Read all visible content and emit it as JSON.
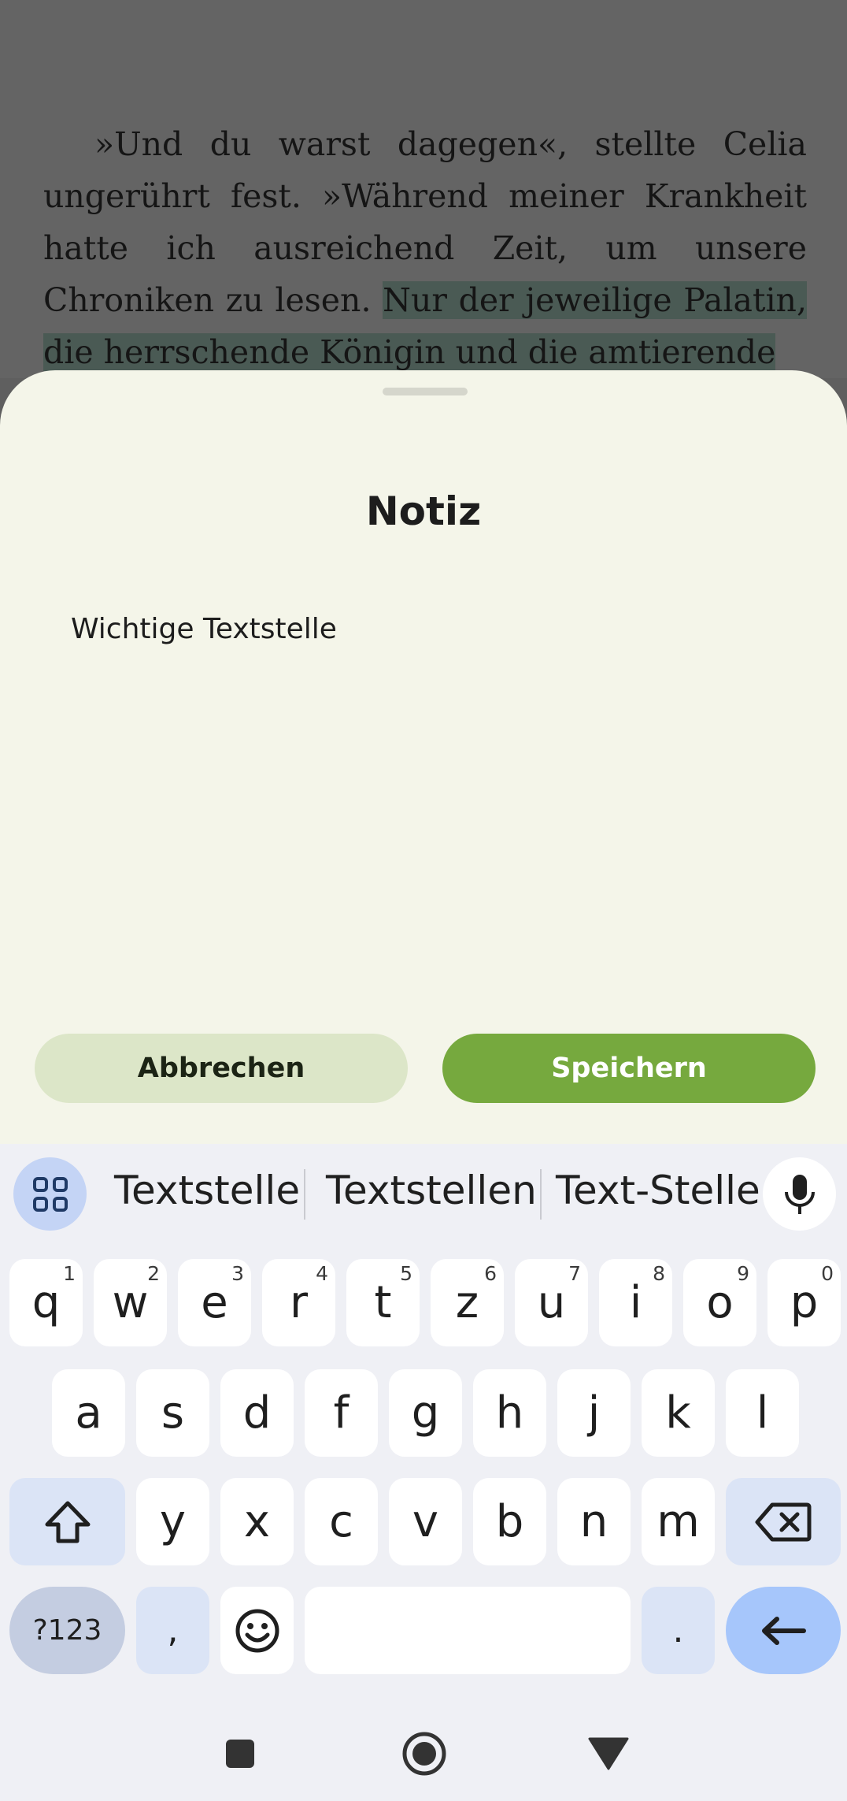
{
  "book": {
    "text_plain": "»Und du warst dagegen«, stellte Celia ungerührt fest. »Während meiner Krankheit hatte ich ausreichend Zeit, um unsere Chroniken zu lesen. ",
    "text_highlighted": "Nur der jeweilige Palatin, die herrschende Königin und die amtierende"
  },
  "sheet": {
    "title": "Notiz",
    "note_value": "Wichtige Textstelle",
    "cancel_label": "Abbrechen",
    "save_label": "Speichern",
    "accent_color": "#76a93e"
  },
  "keyboard": {
    "suggestions": [
      "Textstelle",
      "Textstellen",
      "Text-Stelle"
    ],
    "row1": [
      {
        "key": "q",
        "hint": "1"
      },
      {
        "key": "w",
        "hint": "2"
      },
      {
        "key": "e",
        "hint": "3"
      },
      {
        "key": "r",
        "hint": "4"
      },
      {
        "key": "t",
        "hint": "5"
      },
      {
        "key": "z",
        "hint": "6"
      },
      {
        "key": "u",
        "hint": "7"
      },
      {
        "key": "i",
        "hint": "8"
      },
      {
        "key": "o",
        "hint": "9"
      },
      {
        "key": "p",
        "hint": "0"
      }
    ],
    "row2": [
      "a",
      "s",
      "d",
      "f",
      "g",
      "h",
      "j",
      "k",
      "l"
    ],
    "row3": [
      "y",
      "x",
      "c",
      "v",
      "b",
      "n",
      "m"
    ],
    "symbols_label": "?123",
    "comma_label": ",",
    "period_label": "."
  },
  "icons": {
    "apps": "apps-grid-icon",
    "mic": "microphone-icon",
    "shift": "shift-icon",
    "backspace": "backspace-icon",
    "emoji": "emoji-icon",
    "enter": "enter-icon",
    "recents": "recents-square-icon",
    "home": "home-circle-icon",
    "back": "back-triangle-icon"
  }
}
